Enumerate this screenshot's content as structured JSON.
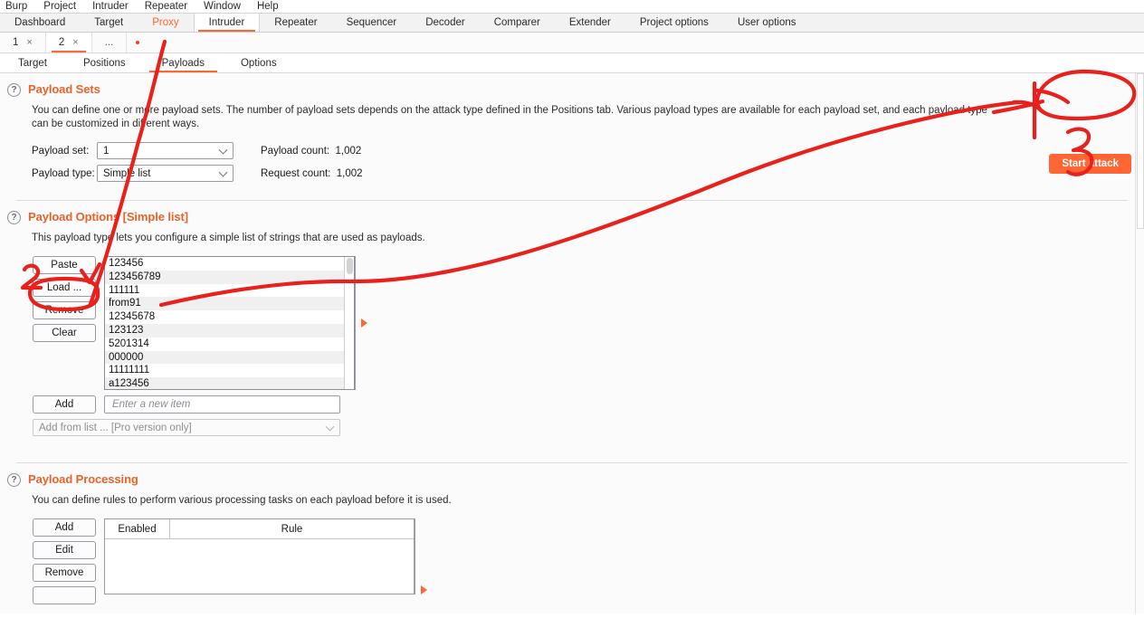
{
  "menubar": {
    "items": [
      "Burp",
      "Project",
      "Intruder",
      "Repeater",
      "Window",
      "Help"
    ]
  },
  "main_tabs": {
    "items": [
      {
        "label": "Dashboard",
        "state": "normal"
      },
      {
        "label": "Target",
        "state": "normal"
      },
      {
        "label": "Proxy",
        "state": "highlight"
      },
      {
        "label": "Intruder",
        "state": "active"
      },
      {
        "label": "Repeater",
        "state": "normal"
      },
      {
        "label": "Sequencer",
        "state": "normal"
      },
      {
        "label": "Decoder",
        "state": "normal"
      },
      {
        "label": "Comparer",
        "state": "normal"
      },
      {
        "label": "Extender",
        "state": "normal"
      },
      {
        "label": "Project options",
        "state": "normal"
      },
      {
        "label": "User options",
        "state": "normal"
      }
    ]
  },
  "attack_tabs": {
    "items": [
      {
        "label": "1",
        "close": "×",
        "active": false
      },
      {
        "label": "2",
        "close": "×",
        "active": true
      }
    ],
    "ellipsis": "...",
    "new_tab_dot": "new-tab-indicator"
  },
  "sub_tabs": {
    "items": [
      {
        "label": "Target",
        "active": false
      },
      {
        "label": "Positions",
        "active": false
      },
      {
        "label": "Payloads",
        "active": true
      },
      {
        "label": "Options",
        "active": false
      }
    ]
  },
  "start_attack": {
    "label": "Start attack",
    "color": "#ff6633"
  },
  "payload_sets": {
    "help_glyph": "?",
    "title": "Payload Sets",
    "description": "You can define one or more payload sets. The number of payload sets depends on the attack type defined in the Positions tab. Various payload types are available for each payload set, and each payload type can be customized in different ways.",
    "payload_set_label": "Payload set:",
    "payload_set_value": "1",
    "payload_type_label": "Payload type:",
    "payload_type_value": "Simple list",
    "payload_count_label": "Payload count:",
    "payload_count_value": "1,002",
    "request_count_label": "Request count:",
    "request_count_value": "1,002"
  },
  "payload_options": {
    "help_glyph": "?",
    "title": "Payload Options [Simple list]",
    "description": "This payload type lets you configure a simple list of strings that are used as payloads.",
    "buttons": [
      "Paste",
      "Load ...",
      "Remove",
      "Clear"
    ],
    "list_items": [
      "123456",
      "123456789",
      "111111",
      "from91",
      "12345678",
      "123123",
      "5201314",
      "000000",
      "11111111",
      "a123456"
    ],
    "add_button": "Add",
    "new_item_placeholder": "Enter a new item",
    "add_from_list_value": "Add from list ... [Pro version only]"
  },
  "payload_processing": {
    "help_glyph": "?",
    "title": "Payload Processing",
    "description": "You can define rules to perform various processing tasks on each payload before it is used.",
    "buttons": [
      "Add",
      "Edit",
      "Remove"
    ],
    "columns": [
      "Enabled",
      "Rule"
    ],
    "rows": []
  },
  "annotations": {
    "marks": [
      {
        "name": "annotation-number-2",
        "text": "2"
      },
      {
        "name": "annotation-number-3",
        "text": "3"
      }
    ],
    "color": "#e8211c"
  }
}
